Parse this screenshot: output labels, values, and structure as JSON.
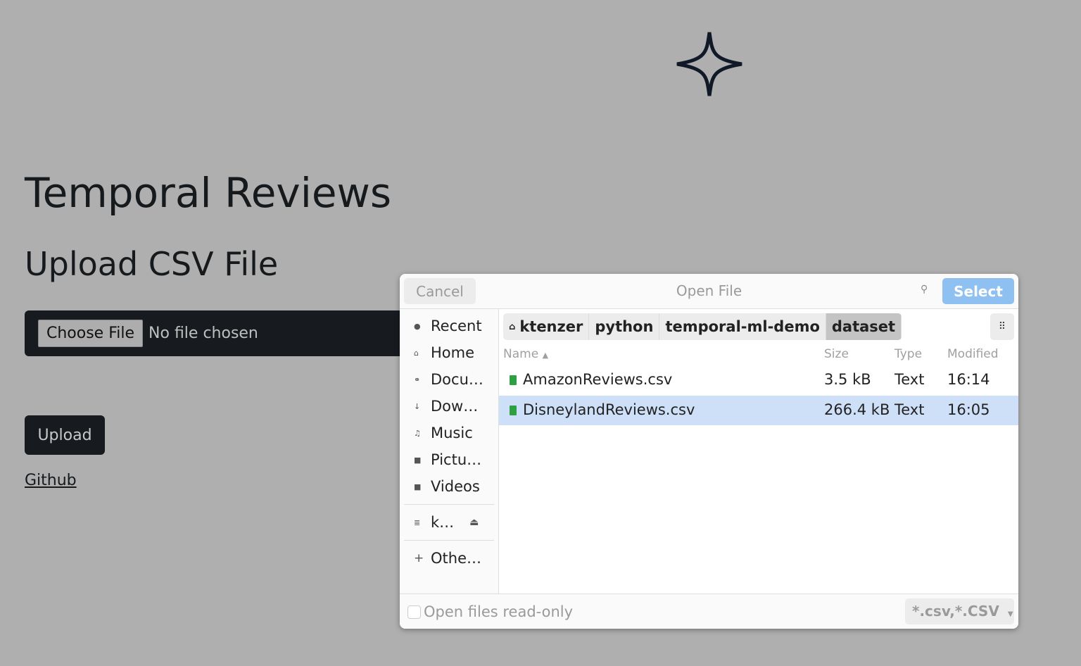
{
  "page": {
    "title": "Temporal Reviews",
    "subtitle": "Upload CSV File",
    "choose_file": "Choose File",
    "no_file": "No file chosen",
    "upload": "Upload",
    "github": "Github"
  },
  "dialog": {
    "cancel": "Cancel",
    "title": "Open File",
    "select": "Select",
    "places": [
      {
        "icon": "clock-icon",
        "glyph": "●",
        "label": "Recent"
      },
      {
        "icon": "home-icon",
        "glyph": "⌂",
        "label": "Home"
      },
      {
        "icon": "documents-icon",
        "glyph": "⚭",
        "label": "Docu…"
      },
      {
        "icon": "download-icon",
        "glyph": "↓",
        "label": "Dow…"
      },
      {
        "icon": "music-icon",
        "glyph": "♫",
        "label": "Music"
      },
      {
        "icon": "pictures-icon",
        "glyph": "■",
        "label": "Pictu…"
      },
      {
        "icon": "videos-icon",
        "glyph": "■",
        "label": "Videos"
      }
    ],
    "drive": {
      "label": "k…"
    },
    "other": {
      "label": "Othe…"
    },
    "breadcrumb": [
      "ktenzer",
      "python",
      "temporal-ml-demo",
      "dataset"
    ],
    "columns": {
      "name": "Name",
      "size": "Size",
      "type": "Type",
      "modified": "Modified"
    },
    "files": [
      {
        "name": "AmazonReviews.csv",
        "size": "3.5 kB",
        "type": "Text",
        "modified": "16:14"
      },
      {
        "name": "DisneylandReviews.csv",
        "size": "266.4 kB",
        "type": "Text",
        "modified": "16:05"
      }
    ],
    "readonly": "Open files read-only",
    "filter": "*.csv,*.CSV"
  }
}
